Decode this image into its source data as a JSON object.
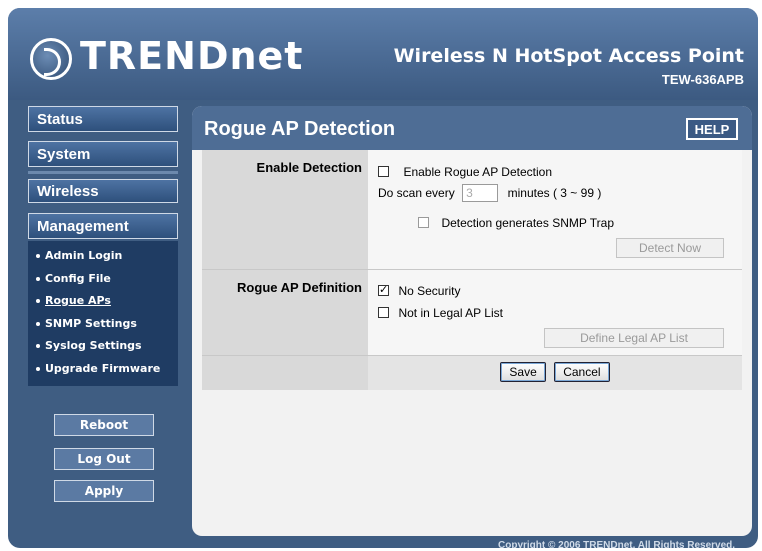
{
  "brand": {
    "logo_text": "TRENDnet",
    "product_title": "Wireless N HotSpot Access Point",
    "model": "TEW-636APB"
  },
  "sidebar": {
    "main_items": [
      {
        "label": "Status"
      },
      {
        "label": "System"
      },
      {
        "label": "Wireless"
      }
    ],
    "management_label": "Management",
    "sub_items": [
      {
        "label": "Admin Login"
      },
      {
        "label": "Config File"
      },
      {
        "label": "Rogue APs"
      },
      {
        "label": "SNMP Settings"
      },
      {
        "label": "Syslog Settings"
      },
      {
        "label": "Upgrade Firmware"
      }
    ],
    "active_sub_item": "Rogue APs",
    "actions": {
      "reboot": "Reboot",
      "logout": "Log Out",
      "apply": "Apply"
    }
  },
  "content": {
    "title": "Rogue AP Detection",
    "help_label": "HELP",
    "enable_detection": {
      "label": "Enable Detection",
      "checkbox_label": "Enable Rogue AP Detection",
      "checked": false,
      "scan_prefix": "Do scan every",
      "scan_value": "3",
      "scan_suffix": "minutes ( 3 ~ 99 )",
      "snmp_label": "Detection generates SNMP Trap",
      "detect_now_label": "Detect Now"
    },
    "definition": {
      "label": "Rogue AP Definition",
      "no_security_label": "No Security",
      "no_security_checked": true,
      "not_legal_label": "Not in Legal AP List",
      "not_legal_checked": false,
      "define_list_label": "Define Legal AP List"
    },
    "save_label": "Save",
    "cancel_label": "Cancel"
  },
  "footer": {
    "copyright": "Copyright © 2006 TRENDnet. All Rights Reserved."
  },
  "colors": {
    "frame": "#3f5d82",
    "header": "#4e6d95",
    "submenu": "#1f3c63"
  }
}
